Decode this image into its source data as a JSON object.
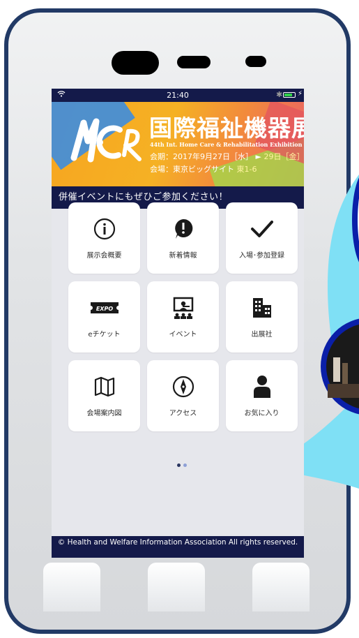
{
  "status_bar": {
    "time": "21:40"
  },
  "banner": {
    "title": "国際福祉機器展",
    "subtitle": "44th Int. Home Care & Rehabilitation Exhibition",
    "date_prefix": "会期：2017年9月27日［水］",
    "date_arrow": "►",
    "date_end": "29日［金］",
    "venue_prefix": "会場：東京ビッグサイト",
    "venue_hall": "東1-6",
    "logo_alt": "HCR"
  },
  "tagline": "併催イベントにもぜひご参加ください！",
  "menu": [
    {
      "label": "展示会概要",
      "icon": "info-icon"
    },
    {
      "label": "新着情報",
      "icon": "notice-icon"
    },
    {
      "label": "入場･参加登録",
      "icon": "check-icon"
    },
    {
      "label": "eチケット",
      "icon": "ticket-icon"
    },
    {
      "label": "イベント",
      "icon": "presentation-icon"
    },
    {
      "label": "出展社",
      "icon": "building-icon"
    },
    {
      "label": "会場案内図",
      "icon": "map-icon"
    },
    {
      "label": "アクセス",
      "icon": "compass-icon"
    },
    {
      "label": "お気に入り",
      "icon": "person-icon"
    }
  ],
  "ticket_text": "EXPO",
  "pagination": {
    "pages": 2,
    "current": 1
  },
  "footer": "© Health and Welfare Information Association All rights reserved."
}
